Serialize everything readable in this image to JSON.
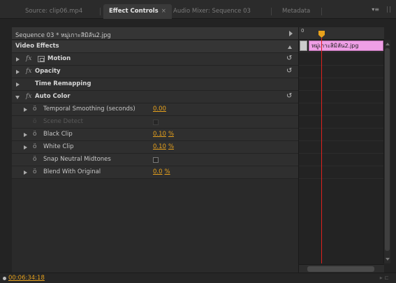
{
  "tabs": [
    {
      "label": "Source: clip06.mp4",
      "active": false
    },
    {
      "label": "Effect Controls",
      "active": true,
      "close": "×"
    },
    {
      "label": "Audio Mixer: Sequence 03",
      "active": false
    },
    {
      "label": "Metadata",
      "active": false
    }
  ],
  "panel_menu_glyph": "▾≡",
  "sequence_title": "Sequence 03 * หมู่เกาะสิมิลัน2.jpg",
  "section_header": "Video Effects",
  "effects": [
    {
      "name": "Motion",
      "has_fx": true,
      "has_motion_icon": true,
      "expanded": false,
      "reset": true
    },
    {
      "name": "Opacity",
      "has_fx": true,
      "expanded": false,
      "reset": true
    },
    {
      "name": "Time Remapping",
      "has_fx": false,
      "expanded": false,
      "reset": false
    },
    {
      "name": "Auto Color",
      "has_fx": true,
      "expanded": true,
      "reset": true
    }
  ],
  "params": [
    {
      "name": "Temporal Smoothing (seconds)",
      "value": "0.00",
      "unit": ""
    },
    {
      "name": "Scene Detect",
      "checkbox": true,
      "disabled": true
    },
    {
      "name": "Black Clip",
      "value": "0.10",
      "unit": "%"
    },
    {
      "name": "White Clip",
      "value": "0.10",
      "unit": "%"
    },
    {
      "name": "Snap Neutral Midtones",
      "checkbox": true
    },
    {
      "name": "Blend With Original",
      "value": "0.0",
      "unit": "%"
    }
  ],
  "timeline": {
    "ruler_zero": "0",
    "clip_label": "หมู่เกาะสิมิลัน2.jpg"
  },
  "timecode": "00:06:34:18",
  "reset_glyph": "↺",
  "fx_glyph": "fx",
  "stopwatch_glyph": "ö",
  "colors": {
    "accent": "#e8a21c",
    "clip": "#ef9fe6",
    "playhead": "#e0211d"
  }
}
